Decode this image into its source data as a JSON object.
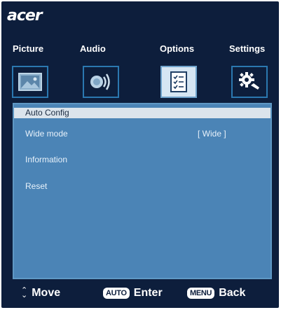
{
  "brand": {
    "logo_text": "acer"
  },
  "tabs": [
    {
      "label": "Picture",
      "icon": "picture-icon"
    },
    {
      "label": "Audio",
      "icon": "speaker-icon"
    },
    {
      "label": "Options",
      "icon": "checklist-icon",
      "active": true
    },
    {
      "label": "Settings",
      "icon": "gear-wrench-icon"
    }
  ],
  "menu": {
    "items": [
      {
        "label": "Auto Config",
        "selected": true
      },
      {
        "label": "Wide mode",
        "value": "[ Wide ]"
      },
      {
        "label": "Information"
      },
      {
        "label": "Reset"
      }
    ]
  },
  "footer": {
    "move_label": "Move",
    "auto_key": "AUTO",
    "enter_label": "Enter",
    "menu_key": "MENU",
    "back_label": "Back"
  },
  "colors": {
    "background": "#0d1e3c",
    "panel": "#4b84b6",
    "selected_row": "#dbe4ec",
    "tab_border": "#2b78b0"
  }
}
